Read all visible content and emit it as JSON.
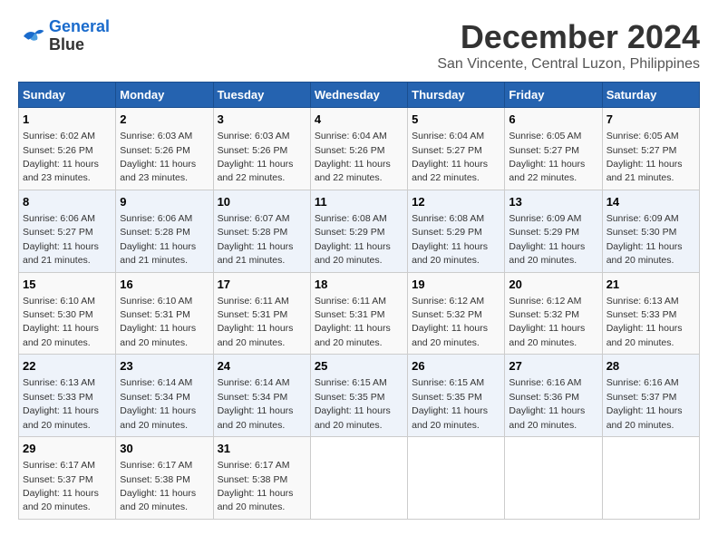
{
  "logo": {
    "line1": "General",
    "line2": "Blue"
  },
  "title": "December 2024",
  "subtitle": "San Vincente, Central Luzon, Philippines",
  "weekdays": [
    "Sunday",
    "Monday",
    "Tuesday",
    "Wednesday",
    "Thursday",
    "Friday",
    "Saturday"
  ],
  "weeks": [
    [
      {
        "day": "1",
        "sunrise": "6:02 AM",
        "sunset": "5:26 PM",
        "daylight": "11 hours and 23 minutes."
      },
      {
        "day": "2",
        "sunrise": "6:03 AM",
        "sunset": "5:26 PM",
        "daylight": "11 hours and 23 minutes."
      },
      {
        "day": "3",
        "sunrise": "6:03 AM",
        "sunset": "5:26 PM",
        "daylight": "11 hours and 22 minutes."
      },
      {
        "day": "4",
        "sunrise": "6:04 AM",
        "sunset": "5:26 PM",
        "daylight": "11 hours and 22 minutes."
      },
      {
        "day": "5",
        "sunrise": "6:04 AM",
        "sunset": "5:27 PM",
        "daylight": "11 hours and 22 minutes."
      },
      {
        "day": "6",
        "sunrise": "6:05 AM",
        "sunset": "5:27 PM",
        "daylight": "11 hours and 22 minutes."
      },
      {
        "day": "7",
        "sunrise": "6:05 AM",
        "sunset": "5:27 PM",
        "daylight": "11 hours and 21 minutes."
      }
    ],
    [
      {
        "day": "8",
        "sunrise": "6:06 AM",
        "sunset": "5:27 PM",
        "daylight": "11 hours and 21 minutes."
      },
      {
        "day": "9",
        "sunrise": "6:06 AM",
        "sunset": "5:28 PM",
        "daylight": "11 hours and 21 minutes."
      },
      {
        "day": "10",
        "sunrise": "6:07 AM",
        "sunset": "5:28 PM",
        "daylight": "11 hours and 21 minutes."
      },
      {
        "day": "11",
        "sunrise": "6:08 AM",
        "sunset": "5:29 PM",
        "daylight": "11 hours and 20 minutes."
      },
      {
        "day": "12",
        "sunrise": "6:08 AM",
        "sunset": "5:29 PM",
        "daylight": "11 hours and 20 minutes."
      },
      {
        "day": "13",
        "sunrise": "6:09 AM",
        "sunset": "5:29 PM",
        "daylight": "11 hours and 20 minutes."
      },
      {
        "day": "14",
        "sunrise": "6:09 AM",
        "sunset": "5:30 PM",
        "daylight": "11 hours and 20 minutes."
      }
    ],
    [
      {
        "day": "15",
        "sunrise": "6:10 AM",
        "sunset": "5:30 PM",
        "daylight": "11 hours and 20 minutes."
      },
      {
        "day": "16",
        "sunrise": "6:10 AM",
        "sunset": "5:31 PM",
        "daylight": "11 hours and 20 minutes."
      },
      {
        "day": "17",
        "sunrise": "6:11 AM",
        "sunset": "5:31 PM",
        "daylight": "11 hours and 20 minutes."
      },
      {
        "day": "18",
        "sunrise": "6:11 AM",
        "sunset": "5:31 PM",
        "daylight": "11 hours and 20 minutes."
      },
      {
        "day": "19",
        "sunrise": "6:12 AM",
        "sunset": "5:32 PM",
        "daylight": "11 hours and 20 minutes."
      },
      {
        "day": "20",
        "sunrise": "6:12 AM",
        "sunset": "5:32 PM",
        "daylight": "11 hours and 20 minutes."
      },
      {
        "day": "21",
        "sunrise": "6:13 AM",
        "sunset": "5:33 PM",
        "daylight": "11 hours and 20 minutes."
      }
    ],
    [
      {
        "day": "22",
        "sunrise": "6:13 AM",
        "sunset": "5:33 PM",
        "daylight": "11 hours and 20 minutes."
      },
      {
        "day": "23",
        "sunrise": "6:14 AM",
        "sunset": "5:34 PM",
        "daylight": "11 hours and 20 minutes."
      },
      {
        "day": "24",
        "sunrise": "6:14 AM",
        "sunset": "5:34 PM",
        "daylight": "11 hours and 20 minutes."
      },
      {
        "day": "25",
        "sunrise": "6:15 AM",
        "sunset": "5:35 PM",
        "daylight": "11 hours and 20 minutes."
      },
      {
        "day": "26",
        "sunrise": "6:15 AM",
        "sunset": "5:35 PM",
        "daylight": "11 hours and 20 minutes."
      },
      {
        "day": "27",
        "sunrise": "6:16 AM",
        "sunset": "5:36 PM",
        "daylight": "11 hours and 20 minutes."
      },
      {
        "day": "28",
        "sunrise": "6:16 AM",
        "sunset": "5:37 PM",
        "daylight": "11 hours and 20 minutes."
      }
    ],
    [
      {
        "day": "29",
        "sunrise": "6:17 AM",
        "sunset": "5:37 PM",
        "daylight": "11 hours and 20 minutes."
      },
      {
        "day": "30",
        "sunrise": "6:17 AM",
        "sunset": "5:38 PM",
        "daylight": "11 hours and 20 minutes."
      },
      {
        "day": "31",
        "sunrise": "6:17 AM",
        "sunset": "5:38 PM",
        "daylight": "11 hours and 20 minutes."
      },
      null,
      null,
      null,
      null
    ]
  ],
  "labels": {
    "sunrise": "Sunrise:",
    "sunset": "Sunset:",
    "daylight": "Daylight:"
  }
}
